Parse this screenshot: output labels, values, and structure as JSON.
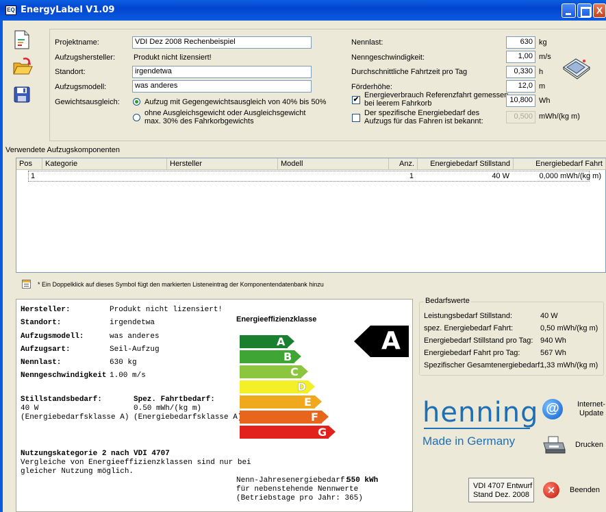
{
  "window": {
    "title": "EnergyLabel V1.09",
    "close_glyph": "X"
  },
  "toolbar": {
    "icons": [
      "new-document-icon",
      "open-folder-icon",
      "save-disk-icon"
    ]
  },
  "project": {
    "name_label": "Projektname:",
    "name_value": "VDI Dez 2008 Rechenbeispiel",
    "manufacturer_label": "Aufzugshersteller:",
    "manufacturer_value": "Produkt nicht lizensiert!",
    "location_label": "Standort:",
    "location_value": "irgendetwa",
    "model_label": "Aufzugsmodell:",
    "model_value": "was anderes",
    "balance_label": "Gewichtsausgleich:",
    "balance_option1": "Aufzug mit Gegengewichtsausgleich von 40% bis 50%",
    "balance_option2_line1": "ohne Ausgleichsgewicht oder Ausgleichsgewicht",
    "balance_option2_line2": "max. 30% des Fahrkorbgewichts"
  },
  "params": {
    "load_label": "Nennlast:",
    "load_value": "630",
    "load_unit": "kg",
    "speed_label": "Nenngeschwindigkeit:",
    "speed_value": "1,00",
    "speed_unit": "m/s",
    "traveltime_label": "Durchschnittliche Fahrtzeit pro Tag",
    "traveltime_value": "0,330",
    "traveltime_unit": "h",
    "height_label": "Förderhöhe:",
    "height_value": "12,0",
    "height_unit": "m",
    "ref_check_line1": "Energieverbrauch Referenzfahrt gemessen",
    "ref_check_line2": "bei leerem Fahrkorb",
    "ref_check_mark": "✔",
    "ref_value": "10,800",
    "ref_unit": "Wh",
    "spec_check_line1": "Der spezifische Energiebedarf des",
    "spec_check_line2": "Aufzugs für das Fahren ist bekannt:",
    "spec_value": "0,500",
    "spec_unit": "mWh/(kg m)"
  },
  "components": {
    "section_label": "Verwendete Aufzugskomponenten",
    "columns": [
      "Pos",
      "Kategorie",
      "Hersteller",
      "Modell",
      "Anz.",
      "Energiebedarf Stillstand",
      "Energiebedarf Fahrt"
    ],
    "rows": [
      {
        "pos": "1",
        "kategorie": "",
        "hersteller": "",
        "modell": "",
        "anz": "1",
        "stillstand": "40 W",
        "fahrt": "0,000 mWh/(kg m)"
      }
    ],
    "hint": "* Ein Doppelklick auf dieses Symbol fügt den markierten Listeneintrag der Komponentendatenbank hinzu"
  },
  "summary": {
    "manufacturer_label": "Hersteller:",
    "manufacturer_value": "Produkt nicht lizensiert!",
    "location_label": "Standort:",
    "location_value": "irgendetwa",
    "model_label": "Aufzugsmodell:",
    "model_value": "was anderes",
    "type_label": "Aufzugsart:",
    "type_value": "Seil-Aufzug",
    "load_label": "Nennlast:",
    "load_value": "630 kg",
    "speed_label": "Nenngeschwindigkeit",
    "speed_value": "1.00 m/s",
    "standby_label": "Stillstandsbedarf:",
    "standby_value": "40 W",
    "standby_class": "(Energiebedarfsklasse A)",
    "travel_label": "Spez. Fahrtbedarf:",
    "travel_value": "0.50 mWh/(kg m)",
    "travel_class": "(Energiebedarfsklasse A)",
    "category_title": "Nutzungskategorie 2 nach VDI 4707",
    "category_note_line1": "Vergleiche von Energieeffizienzklassen sind nur bei",
    "category_note_line2": "gleicher Nutzung möglich."
  },
  "efficiency": {
    "title": "Energieeffizienzklasse",
    "classes": [
      {
        "letter": "A",
        "color": "#1a7f2e"
      },
      {
        "letter": "B",
        "color": "#3fa535"
      },
      {
        "letter": "C",
        "color": "#8cc63f"
      },
      {
        "letter": "D",
        "color": "#f4f028"
      },
      {
        "letter": "E",
        "color": "#f0a81c"
      },
      {
        "letter": "F",
        "color": "#e8661b"
      },
      {
        "letter": "G",
        "color": "#e2201c"
      }
    ],
    "rating": "A",
    "annual_label": "Nenn-Jahresenergiebedarf:",
    "annual_value": "550 kWh",
    "annual_note1": "für nebenstehende Nennwerte",
    "annual_note2": "(Betriebstage pro Jahr: 365)"
  },
  "requirements": {
    "title": "Bedarfswerte",
    "rows": [
      {
        "label": "Leistungsbedarf Stillstand:",
        "value": "40 W"
      },
      {
        "label": "spez. Energiebedarf Fahrt:",
        "value": "0,50 mWh/(kg m)"
      },
      {
        "label": "Energiebedarf Stillstand pro Tag:",
        "value": "940 Wh"
      },
      {
        "label": "Energiebedarf Fahrt pro Tag:",
        "value": "567 Wh"
      },
      {
        "label": "Spezifischer Gesamtenergiebedarf:",
        "value": "1,33 mWh/(kg m)"
      }
    ]
  },
  "brand": {
    "name": "henning",
    "tagline": "Made in Germany",
    "color": "#1f6fb5"
  },
  "actions": {
    "update_line1": "Internet-",
    "update_line2": "Update",
    "print": "Drucken",
    "standard_line1": "VDI 4707 Entwurf",
    "standard_line2": "Stand Dez. 2008",
    "exit": "Beenden",
    "update_glyph": "@",
    "exit_glyph": "✕"
  }
}
